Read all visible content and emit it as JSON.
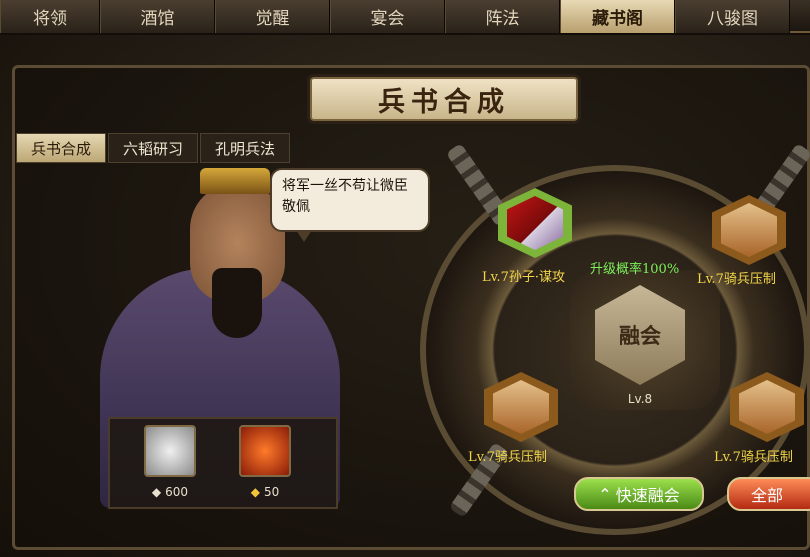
{
  "tabs": [
    {
      "label": "将领"
    },
    {
      "label": "酒馆"
    },
    {
      "label": "觉醒"
    },
    {
      "label": "宴会"
    },
    {
      "label": "阵法"
    },
    {
      "label": "藏书阁",
      "active": true
    },
    {
      "label": "八骏图"
    }
  ],
  "banner_title": "兵书合成",
  "subtabs": [
    {
      "label": "兵书合成",
      "active": true
    },
    {
      "label": "六韬研习"
    },
    {
      "label": "孔明兵法"
    }
  ],
  "speech": "将军一丝不苟让微臣敬佩",
  "costs": [
    {
      "icon": "silver-item-icon",
      "value": "600"
    },
    {
      "icon": "fire-item-icon",
      "value": "50"
    }
  ],
  "fusion": {
    "button_label": "融会",
    "level": "Lv.8",
    "success_rate": "升级概率100%"
  },
  "items": [
    {
      "label": "Lv.7孙子·谋攻",
      "selected": true
    },
    {
      "label": "Lv.7骑兵压制"
    },
    {
      "label": "Lv.7骑兵压制"
    },
    {
      "label": "Lv.7骑兵压制"
    }
  ],
  "buttons": {
    "quick_fuse": "快速融会",
    "all": "全部"
  },
  "colors": {
    "accent_gold": "#f3d64a",
    "rate_green": "#7df05a"
  }
}
